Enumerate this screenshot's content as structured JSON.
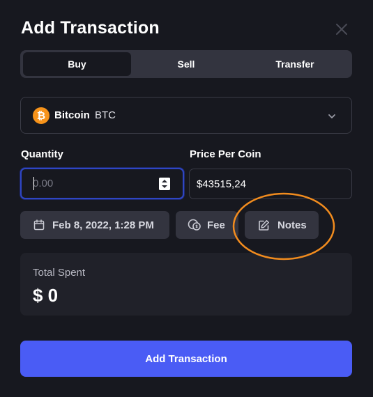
{
  "dialog": {
    "title": "Add Transaction"
  },
  "tabs": [
    {
      "label": "Buy",
      "active": true
    },
    {
      "label": "Sell",
      "active": false
    },
    {
      "label": "Transfer",
      "active": false
    }
  ],
  "coin": {
    "name": "Bitcoin",
    "symbol": "BTC",
    "logo_glyph": "₿",
    "logo_color": "#f7931a"
  },
  "quantity": {
    "label": "Quantity",
    "value": "",
    "placeholder": "0.00"
  },
  "price": {
    "label": "Price Per Coin",
    "value": "$43515,24"
  },
  "actions": {
    "date_label": "Feb 8, 2022, 1:28 PM",
    "fee_label": "Fee",
    "notes_label": "Notes"
  },
  "total": {
    "label": "Total Spent",
    "value": "$ 0"
  },
  "submit_label": "Add Transaction",
  "colors": {
    "background": "#17181f",
    "accent": "#4a5cf5",
    "highlight_annotation": "#f28c1e"
  },
  "icons": {
    "close": "close-icon",
    "chevron": "chevron-down-icon",
    "calendar": "calendar-icon",
    "fee": "fee-icon",
    "notes": "edit-icon"
  }
}
